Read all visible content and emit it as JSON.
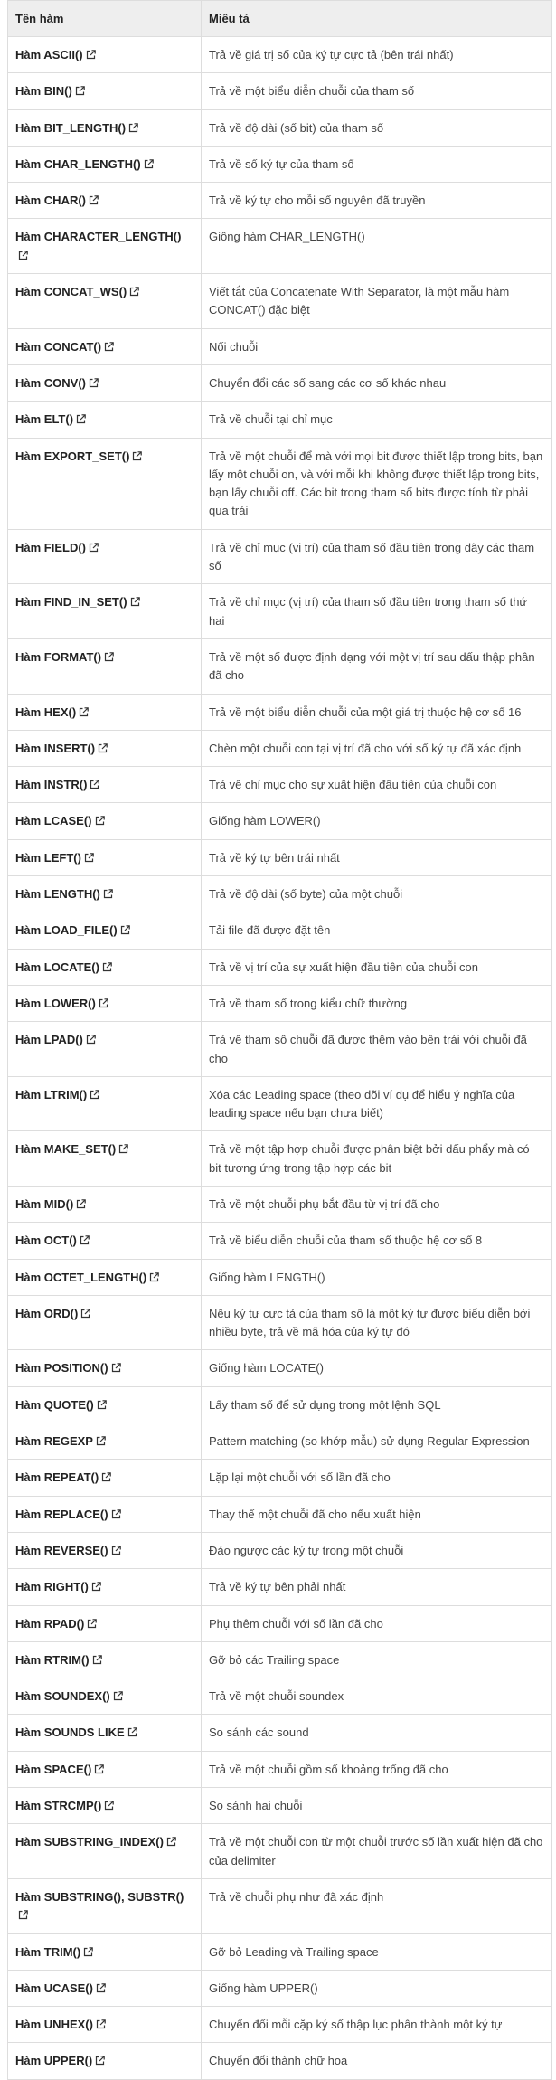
{
  "table": {
    "headers": [
      "Tên hàm",
      "Miêu tả"
    ],
    "rows": [
      {
        "name": "Hàm ASCII()",
        "desc": "Trả về giá trị số của ký tự cực tả (bên trái nhất)"
      },
      {
        "name": "Hàm BIN()",
        "desc": "Trả về một biểu diễn chuỗi của tham số"
      },
      {
        "name": "Hàm BIT_LENGTH()",
        "desc": "Trả về độ dài (số bit) của tham số"
      },
      {
        "name": "Hàm CHAR_LENGTH()",
        "desc": "Trả về số ký tự của tham số"
      },
      {
        "name": "Hàm CHAR()",
        "desc": "Trả về ký tự cho mỗi số nguyên đã truyền"
      },
      {
        "name": "Hàm CHARACTER_LENGTH()",
        "desc": "Giống hàm CHAR_LENGTH()"
      },
      {
        "name": "Hàm CONCAT_WS()",
        "desc": "Viết tắt của Concatenate With Separator, là một mẫu hàm CONCAT() đặc biệt"
      },
      {
        "name": "Hàm CONCAT()",
        "desc": "Nối chuỗi"
      },
      {
        "name": "Hàm CONV()",
        "desc": "Chuyển đổi các số sang các cơ số khác nhau"
      },
      {
        "name": "Hàm ELT()",
        "desc": "Trả về chuỗi tại chỉ mục"
      },
      {
        "name": "Hàm EXPORT_SET()",
        "desc": "Trả về một chuỗi để mà với mọi bit được thiết lập trong bits, bạn lấy một chuỗi on, và với mỗi khi không được thiết lập trong bits, bạn lấy chuỗi off. Các bit trong tham số bits được tính từ phải qua trái"
      },
      {
        "name": "Hàm FIELD()",
        "desc": "Trả về chỉ mục (vị trí) của tham số đầu tiên trong dãy các tham số"
      },
      {
        "name": "Hàm FIND_IN_SET()",
        "desc": "Trả về chỉ mục (vị trí) của tham số đầu tiên trong tham số thứ hai"
      },
      {
        "name": "Hàm FORMAT()",
        "desc": "Trả về một số được định dạng với một vị trí sau dấu thập phân đã cho"
      },
      {
        "name": "Hàm HEX()",
        "desc": "Trả về một biểu diễn chuỗi của một giá trị thuộc hệ cơ số 16"
      },
      {
        "name": "Hàm INSERT()",
        "desc": "Chèn một chuỗi con tại vị trí đã cho với số ký tự đã xác định"
      },
      {
        "name": "Hàm INSTR()",
        "desc": "Trả về chỉ mục cho sự xuất hiện đầu tiên của chuỗi con"
      },
      {
        "name": "Hàm LCASE()",
        "desc": "Giống hàm LOWER()"
      },
      {
        "name": "Hàm LEFT()",
        "desc": "Trả về ký tự bên trái nhất"
      },
      {
        "name": "Hàm LENGTH()",
        "desc": "Trả về độ dài (số byte) của một chuỗi"
      },
      {
        "name": "Hàm LOAD_FILE()",
        "desc": "Tải file đã được đặt tên"
      },
      {
        "name": "Hàm LOCATE()",
        "desc": "Trả về vị trí của sự xuất hiện đầu tiên của chuỗi con"
      },
      {
        "name": "Hàm LOWER()",
        "desc": "Trả về tham số trong kiểu chữ thường"
      },
      {
        "name": "Hàm LPAD()",
        "desc": "Trả về tham số chuỗi đã được thêm vào bên trái với chuỗi đã cho"
      },
      {
        "name": "Hàm LTRIM()",
        "desc": "Xóa các Leading space (theo dõi ví dụ để hiểu ý nghĩa của leading space nếu bạn chưa biết)"
      },
      {
        "name": "Hàm MAKE_SET()",
        "desc": "Trả về một tập hợp chuỗi được phân biệt bởi dấu phẩy mà có bit tương ứng trong tập hợp các bit"
      },
      {
        "name": "Hàm MID()",
        "desc": "Trả về một chuỗi phụ bắt đầu từ vị trí đã cho"
      },
      {
        "name": "Hàm OCT()",
        "desc": "Trả về biểu diễn chuỗi của tham số thuộc hệ cơ số 8"
      },
      {
        "name": "Hàm OCTET_LENGTH()",
        "desc": "Giống hàm LENGTH()"
      },
      {
        "name": "Hàm ORD()",
        "desc": "Nếu ký tự cực tả của tham số là một ký tự được biểu diễn bởi nhiều byte, trả về mã hóa của ký tự đó"
      },
      {
        "name": "Hàm POSITION()",
        "desc": "Giống hàm LOCATE()"
      },
      {
        "name": "Hàm QUOTE()",
        "desc": "Lấy tham số để sử dụng trong một lệnh SQL"
      },
      {
        "name": "Hàm REGEXP",
        "desc": "Pattern matching (so khớp mẫu) sử dụng Regular Expression"
      },
      {
        "name": "Hàm REPEAT()",
        "desc": "Lặp lại một chuỗi với số lần đã cho"
      },
      {
        "name": "Hàm REPLACE()",
        "desc": "Thay thế một chuỗi đã cho nếu xuất hiện"
      },
      {
        "name": "Hàm REVERSE()",
        "desc": "Đảo ngược các ký tự trong một chuỗi"
      },
      {
        "name": "Hàm RIGHT()",
        "desc": "Trả về ký tự bên phải nhất"
      },
      {
        "name": "Hàm RPAD()",
        "desc": "Phụ thêm chuỗi với số lần đã cho"
      },
      {
        "name": "Hàm RTRIM()",
        "desc": "Gỡ bỏ các Trailing space"
      },
      {
        "name": "Hàm SOUNDEX()",
        "desc": "Trả về một chuỗi soundex"
      },
      {
        "name": "Hàm SOUNDS LIKE",
        "desc": "So sánh các sound"
      },
      {
        "name": "Hàm SPACE()",
        "desc": "Trả về một chuỗi gồm số khoảng trống đã cho"
      },
      {
        "name": "Hàm STRCMP()",
        "desc": "So sánh hai chuỗi"
      },
      {
        "name": "Hàm SUBSTRING_INDEX()",
        "desc": "Trả về một chuỗi con từ một chuỗi trước số lần xuất hiện đã cho của delimiter"
      },
      {
        "name": "Hàm SUBSTRING(), SUBSTR()",
        "desc": "Trả về chuỗi phụ như đã xác định"
      },
      {
        "name": "Hàm TRIM()",
        "desc": "Gỡ bỏ Leading và Trailing space"
      },
      {
        "name": "Hàm UCASE()",
        "desc": "Giống hàm UPPER()"
      },
      {
        "name": "Hàm UNHEX()",
        "desc": "Chuyển đổi mỗi cặp ký số thập lục phân thành một ký tự"
      },
      {
        "name": "Hàm UPPER()",
        "desc": "Chuyển đổi thành chữ hoa"
      }
    ]
  },
  "icons": {
    "link": "external-link-icon"
  },
  "colors": {
    "header_bg": "#eeeeee",
    "border": "#dddddd"
  }
}
